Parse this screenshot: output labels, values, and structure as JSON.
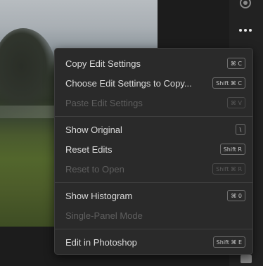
{
  "menu": {
    "items": [
      {
        "label": "Copy Edit Settings",
        "shortcut": "⌘ C"
      },
      {
        "label": "Choose Edit Settings to Copy...",
        "shortcut": "Shift ⌘ C"
      },
      {
        "label": "Paste Edit Settings",
        "shortcut": "⌘ V",
        "disabled": true
      },
      {
        "label": "Show Original",
        "shortcut": "\\"
      },
      {
        "label": "Reset Edits",
        "shortcut": "Shift R"
      },
      {
        "label": "Reset to Open",
        "shortcut": "Shift ⌘ R",
        "disabled": true
      },
      {
        "label": "Show Histogram",
        "shortcut": "⌘ 0"
      },
      {
        "label": "Single-Panel Mode",
        "disabled": true
      },
      {
        "label": "Edit in Photoshop",
        "shortcut": "Shift ⌘ E"
      }
    ]
  },
  "icons": {
    "more": "more-horizontal-icon",
    "radio": "radio-icon",
    "comment": "comment-icon"
  }
}
